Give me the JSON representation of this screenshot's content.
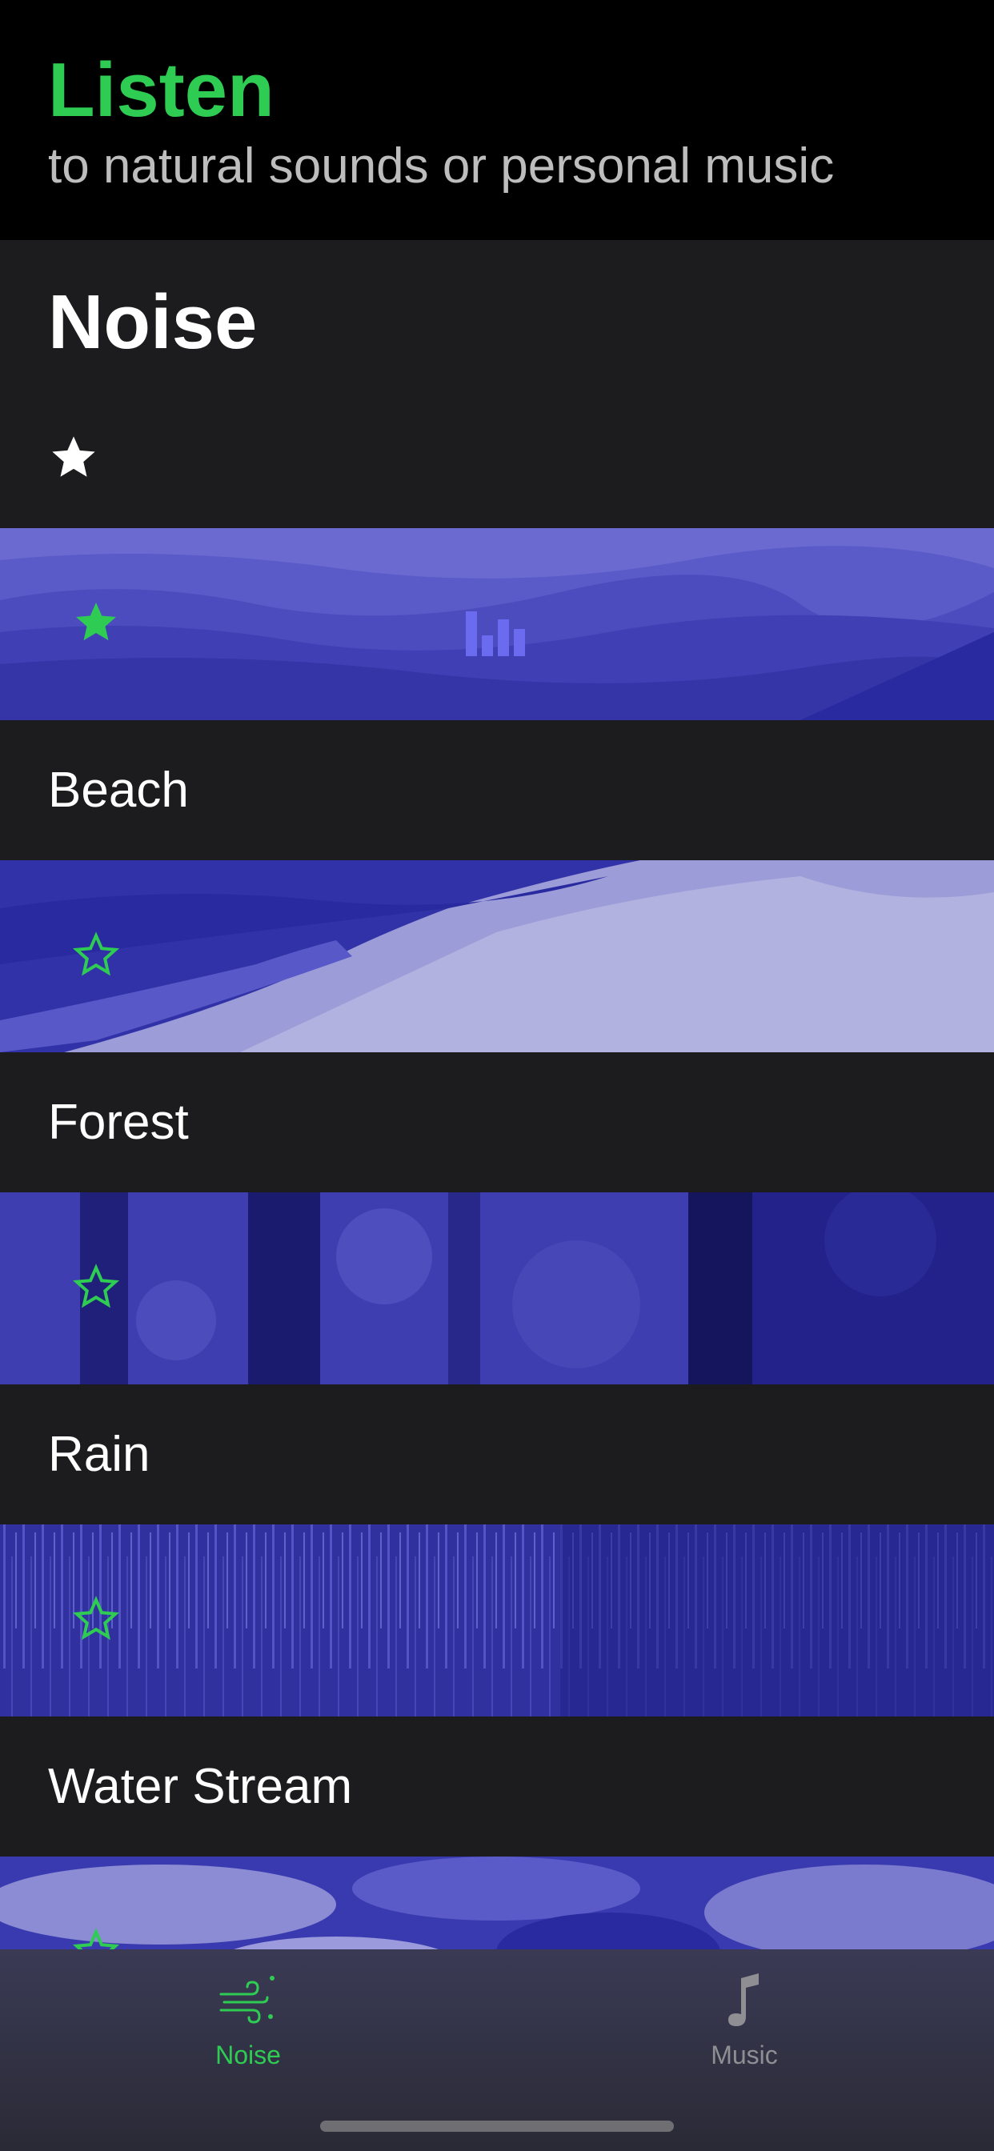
{
  "header": {
    "title": "Listen",
    "subtitle": "to natural sounds or personal music"
  },
  "section": {
    "title": "Noise"
  },
  "colors": {
    "accent": "#2ecc52",
    "banner_base": "#3b3bb0"
  },
  "sounds": [
    {
      "label": "",
      "favorited": true,
      "playing": true,
      "scene": "mountains"
    },
    {
      "label": "Beach",
      "favorited": false,
      "playing": false,
      "scene": "beach"
    },
    {
      "label": "Forest",
      "favorited": false,
      "playing": false,
      "scene": "forest"
    },
    {
      "label": "Rain",
      "favorited": false,
      "playing": false,
      "scene": "rain"
    },
    {
      "label": "Water Stream",
      "favorited": false,
      "playing": false,
      "scene": "stream"
    }
  ],
  "tabs": [
    {
      "label": "Noise",
      "icon": "wind-icon",
      "active": true
    },
    {
      "label": "Music",
      "icon": "music-note-icon",
      "active": false
    }
  ]
}
